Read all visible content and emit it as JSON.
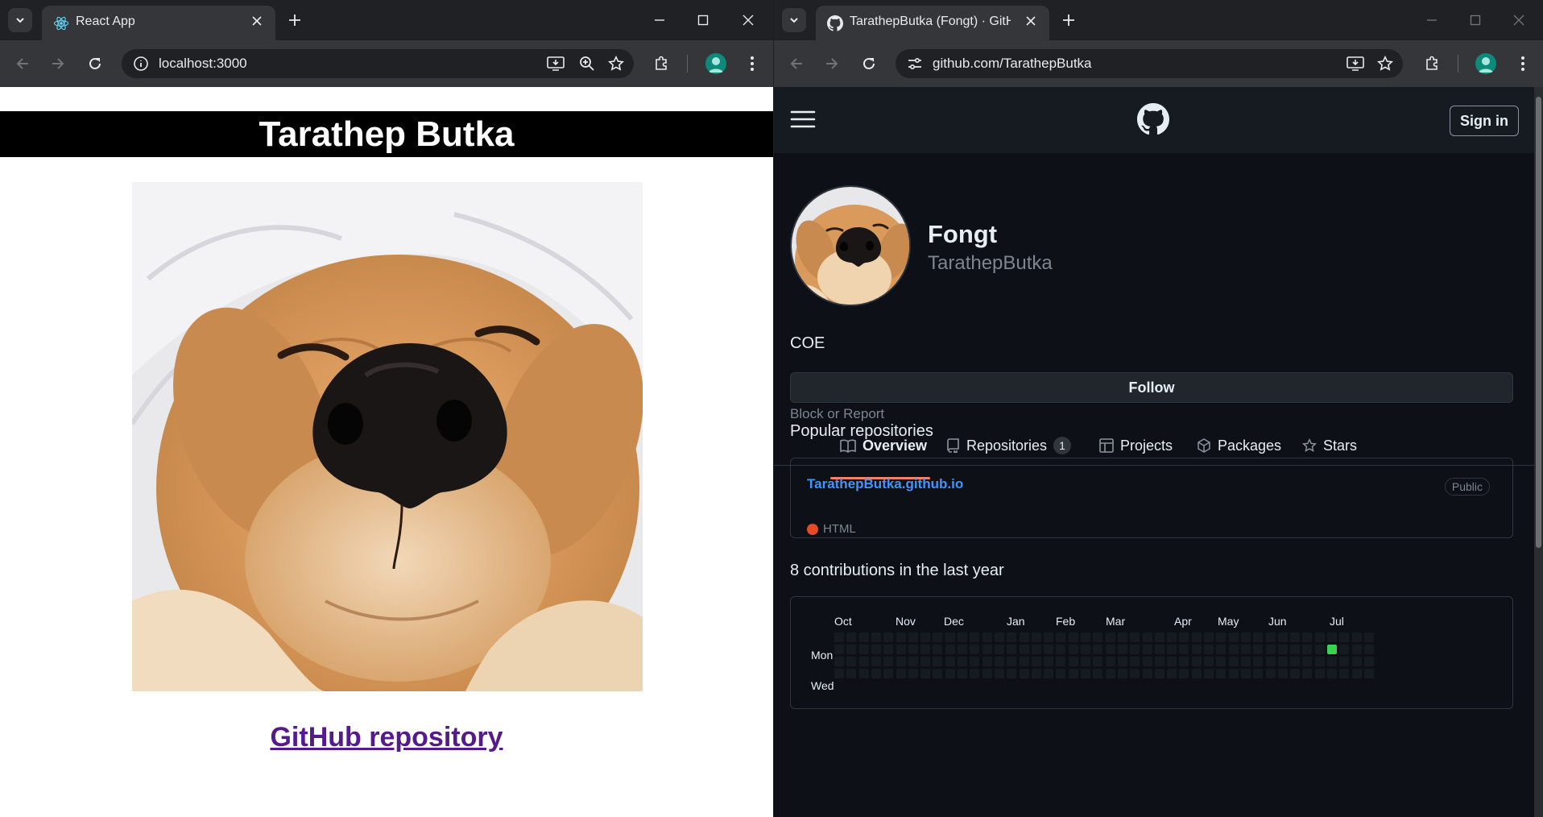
{
  "left_window": {
    "tab": {
      "title": "React App",
      "favicon": "react-logo-icon"
    },
    "address": {
      "url": "localhost:3000"
    },
    "page": {
      "header": "Tarathep Butka",
      "link": "GitHub repository"
    }
  },
  "right_window": {
    "tab": {
      "title": "TarathepButka (Fongt) · GitHub",
      "favicon": "github-logo-icon"
    },
    "address": {
      "url": "github.com/TarathepButka"
    },
    "page": {
      "sign_in": "Sign in",
      "name": "Fongt",
      "login": "TarathepButka",
      "bio": "COE",
      "follow": "Follow",
      "block": "Block or Report",
      "tabs": [
        {
          "label": "Overview",
          "icon": "book-icon"
        },
        {
          "label": "Repositories",
          "icon": "repo-icon",
          "count": "1"
        },
        {
          "label": "Projects",
          "icon": "table-icon"
        },
        {
          "label": "Packages",
          "icon": "package-icon"
        },
        {
          "label": "Stars",
          "icon": "star-icon"
        }
      ],
      "popular_title": "Popular repositories",
      "repo": {
        "name": "TarathepButka.github.io",
        "visibility": "Public",
        "language": "HTML",
        "language_color": "#e34c26"
      },
      "contrib_title": "8 contributions in the last year",
      "months": [
        "Oct",
        "Nov",
        "Dec",
        "Jan",
        "Feb",
        "Mar",
        "Apr",
        "May",
        "Jun",
        "Jul"
      ],
      "days": [
        "Mon",
        "Wed"
      ]
    }
  },
  "colors": {
    "accent_tab_underline": "#f78166",
    "link_blue": "#4493f8",
    "contrib_green": "#39d353"
  }
}
